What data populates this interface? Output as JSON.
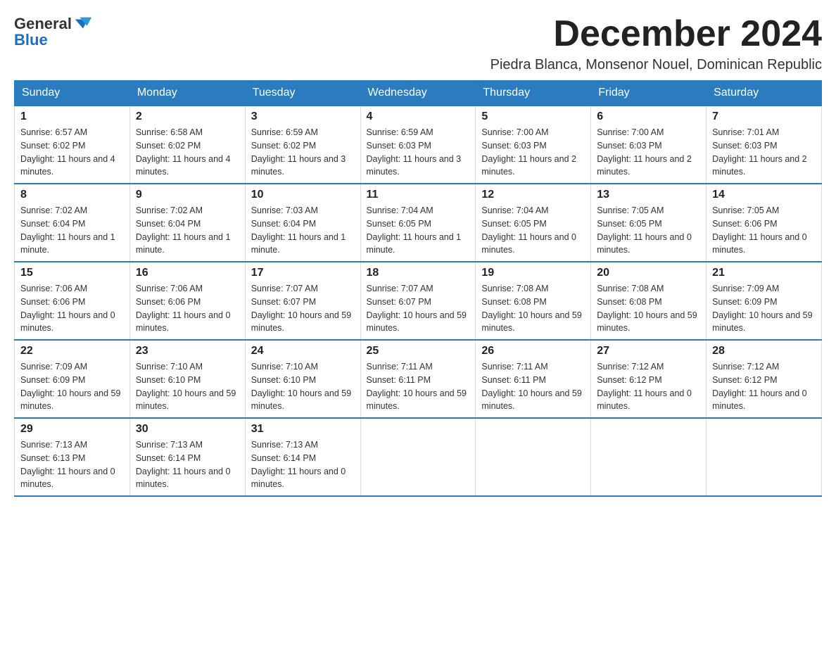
{
  "logo": {
    "text_general": "General",
    "text_blue": "Blue",
    "icon_alt": "GeneralBlue logo"
  },
  "header": {
    "month_title": "December 2024",
    "subtitle": "Piedra Blanca, Monsenor Nouel, Dominican Republic"
  },
  "days_of_week": [
    "Sunday",
    "Monday",
    "Tuesday",
    "Wednesday",
    "Thursday",
    "Friday",
    "Saturday"
  ],
  "weeks": [
    [
      {
        "day": "1",
        "sunrise": "6:57 AM",
        "sunset": "6:02 PM",
        "daylight": "11 hours and 4 minutes."
      },
      {
        "day": "2",
        "sunrise": "6:58 AM",
        "sunset": "6:02 PM",
        "daylight": "11 hours and 4 minutes."
      },
      {
        "day": "3",
        "sunrise": "6:59 AM",
        "sunset": "6:02 PM",
        "daylight": "11 hours and 3 minutes."
      },
      {
        "day": "4",
        "sunrise": "6:59 AM",
        "sunset": "6:03 PM",
        "daylight": "11 hours and 3 minutes."
      },
      {
        "day": "5",
        "sunrise": "7:00 AM",
        "sunset": "6:03 PM",
        "daylight": "11 hours and 2 minutes."
      },
      {
        "day": "6",
        "sunrise": "7:00 AM",
        "sunset": "6:03 PM",
        "daylight": "11 hours and 2 minutes."
      },
      {
        "day": "7",
        "sunrise": "7:01 AM",
        "sunset": "6:03 PM",
        "daylight": "11 hours and 2 minutes."
      }
    ],
    [
      {
        "day": "8",
        "sunrise": "7:02 AM",
        "sunset": "6:04 PM",
        "daylight": "11 hours and 1 minute."
      },
      {
        "day": "9",
        "sunrise": "7:02 AM",
        "sunset": "6:04 PM",
        "daylight": "11 hours and 1 minute."
      },
      {
        "day": "10",
        "sunrise": "7:03 AM",
        "sunset": "6:04 PM",
        "daylight": "11 hours and 1 minute."
      },
      {
        "day": "11",
        "sunrise": "7:04 AM",
        "sunset": "6:05 PM",
        "daylight": "11 hours and 1 minute."
      },
      {
        "day": "12",
        "sunrise": "7:04 AM",
        "sunset": "6:05 PM",
        "daylight": "11 hours and 0 minutes."
      },
      {
        "day": "13",
        "sunrise": "7:05 AM",
        "sunset": "6:05 PM",
        "daylight": "11 hours and 0 minutes."
      },
      {
        "day": "14",
        "sunrise": "7:05 AM",
        "sunset": "6:06 PM",
        "daylight": "11 hours and 0 minutes."
      }
    ],
    [
      {
        "day": "15",
        "sunrise": "7:06 AM",
        "sunset": "6:06 PM",
        "daylight": "11 hours and 0 minutes."
      },
      {
        "day": "16",
        "sunrise": "7:06 AM",
        "sunset": "6:06 PM",
        "daylight": "11 hours and 0 minutes."
      },
      {
        "day": "17",
        "sunrise": "7:07 AM",
        "sunset": "6:07 PM",
        "daylight": "10 hours and 59 minutes."
      },
      {
        "day": "18",
        "sunrise": "7:07 AM",
        "sunset": "6:07 PM",
        "daylight": "10 hours and 59 minutes."
      },
      {
        "day": "19",
        "sunrise": "7:08 AM",
        "sunset": "6:08 PM",
        "daylight": "10 hours and 59 minutes."
      },
      {
        "day": "20",
        "sunrise": "7:08 AM",
        "sunset": "6:08 PM",
        "daylight": "10 hours and 59 minutes."
      },
      {
        "day": "21",
        "sunrise": "7:09 AM",
        "sunset": "6:09 PM",
        "daylight": "10 hours and 59 minutes."
      }
    ],
    [
      {
        "day": "22",
        "sunrise": "7:09 AM",
        "sunset": "6:09 PM",
        "daylight": "10 hours and 59 minutes."
      },
      {
        "day": "23",
        "sunrise": "7:10 AM",
        "sunset": "6:10 PM",
        "daylight": "10 hours and 59 minutes."
      },
      {
        "day": "24",
        "sunrise": "7:10 AM",
        "sunset": "6:10 PM",
        "daylight": "10 hours and 59 minutes."
      },
      {
        "day": "25",
        "sunrise": "7:11 AM",
        "sunset": "6:11 PM",
        "daylight": "10 hours and 59 minutes."
      },
      {
        "day": "26",
        "sunrise": "7:11 AM",
        "sunset": "6:11 PM",
        "daylight": "10 hours and 59 minutes."
      },
      {
        "day": "27",
        "sunrise": "7:12 AM",
        "sunset": "6:12 PM",
        "daylight": "11 hours and 0 minutes."
      },
      {
        "day": "28",
        "sunrise": "7:12 AM",
        "sunset": "6:12 PM",
        "daylight": "11 hours and 0 minutes."
      }
    ],
    [
      {
        "day": "29",
        "sunrise": "7:13 AM",
        "sunset": "6:13 PM",
        "daylight": "11 hours and 0 minutes."
      },
      {
        "day": "30",
        "sunrise": "7:13 AM",
        "sunset": "6:14 PM",
        "daylight": "11 hours and 0 minutes."
      },
      {
        "day": "31",
        "sunrise": "7:13 AM",
        "sunset": "6:14 PM",
        "daylight": "11 hours and 0 minutes."
      },
      null,
      null,
      null,
      null
    ]
  ],
  "labels": {
    "sunrise_prefix": "Sunrise: ",
    "sunset_prefix": "Sunset: ",
    "daylight_prefix": "Daylight: "
  }
}
